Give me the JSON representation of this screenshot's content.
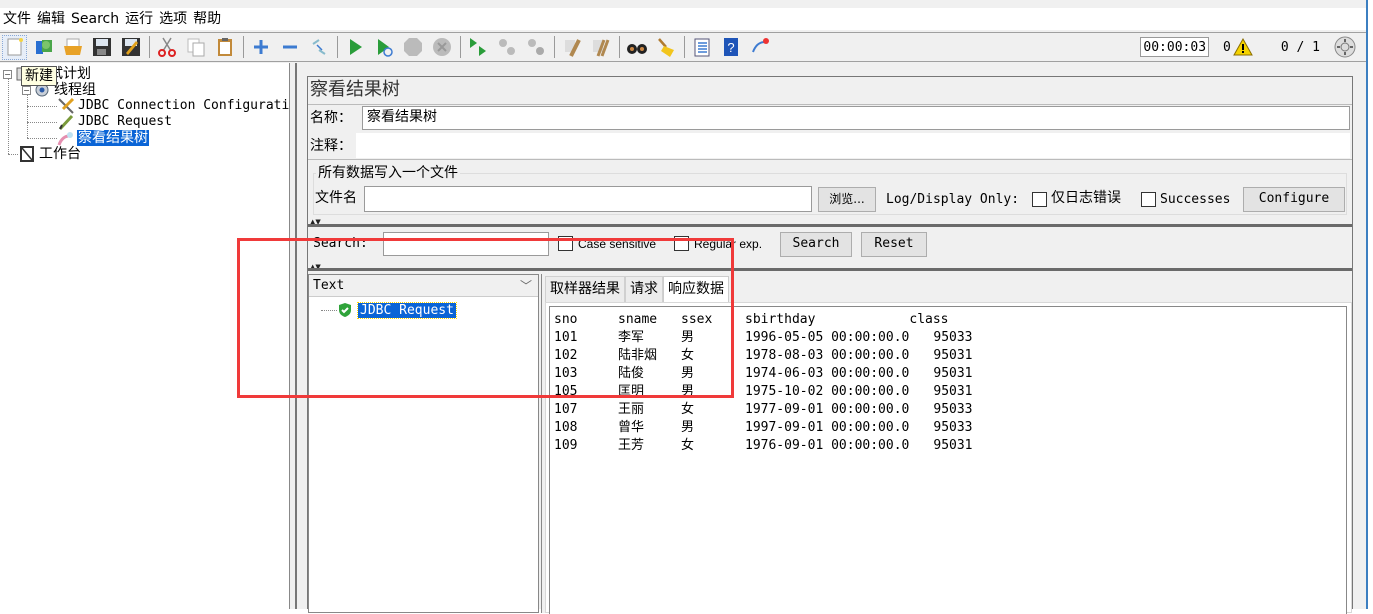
{
  "menu": [
    "文件",
    "编辑",
    "Search",
    "运行",
    "选项",
    "帮助"
  ],
  "toolbar": {
    "icons": [
      "new-icon",
      "templates-icon",
      "open-icon",
      "save-icon",
      "save-as-icon",
      "cut-icon",
      "copy-icon",
      "paste-icon",
      "expand-icon",
      "collapse-icon",
      "toggle-icon",
      "start-icon",
      "start-no-pauses-icon",
      "stop-icon",
      "shutdown-icon",
      "remote-start-icon",
      "remote-stop-icon",
      "remote-shutdown-icon",
      "clear-icon",
      "clear-all-icon",
      "search-icon",
      "reset-search-icon",
      "function-helper-icon",
      "help-icon",
      "log-viewer-icon"
    ],
    "timer": "00:00:03",
    "warning_count": "0",
    "threads": "0 / 1"
  },
  "tooltip": "新建",
  "tree": {
    "nodes": [
      {
        "label": "测试计划",
        "level": 0,
        "icon": "test-plan-icon"
      },
      {
        "label": "线程组",
        "level": 1,
        "icon": "thread-group-icon"
      },
      {
        "label": "JDBC Connection Configurati",
        "level": 2,
        "icon": "config-wrench-icon"
      },
      {
        "label": "JDBC Request",
        "level": 2,
        "icon": "sampler-pen-icon"
      },
      {
        "label": "察看结果树",
        "level": 2,
        "icon": "listener-icon",
        "selected": true
      },
      {
        "label": "工作台",
        "level": 0,
        "icon": "workbench-icon"
      }
    ]
  },
  "panel": {
    "title": "察看结果树",
    "name_label": "名称：",
    "name_value": "察看结果树",
    "comment_label": "注释：",
    "comment_value": "",
    "file_group_label": "所有数据写入一个文件",
    "filename_label": "文件名",
    "filename_value": "",
    "browse_label": "浏览...",
    "log_display_label": "Log/Display Only:",
    "errors_only_label": "仅日志错误",
    "successes_label": "Successes",
    "configure_label": "Configure"
  },
  "search": {
    "label": "Search:",
    "value": "",
    "case_sensitive_label": "Case sensitive",
    "regex_label": "Regular exp.",
    "search_button": "Search",
    "reset_button": "Reset"
  },
  "results": {
    "renderer": "Text",
    "items": [
      {
        "label": "JDBC Request",
        "status": "success"
      }
    ],
    "tabs": [
      "取样器结果",
      "请求",
      "响应数据"
    ],
    "active_tab": "响应数据",
    "columns": [
      "sno",
      "sname",
      "ssex",
      "sbirthday",
      "class"
    ],
    "rows": [
      [
        "101",
        "李军",
        "男",
        "1996-05-05 00:00:00.0",
        "95033"
      ],
      [
        "102",
        "陆非烟",
        "女",
        "1978-08-03 00:00:00.0",
        "95031"
      ],
      [
        "103",
        "陆俊",
        "男",
        "1974-06-03 00:00:00.0",
        "95031"
      ],
      [
        "105",
        "匡明",
        "男",
        "1975-10-02 00:00:00.0",
        "95031"
      ],
      [
        "107",
        "王丽",
        "女",
        "1977-09-01 00:00:00.0",
        "95033"
      ],
      [
        "108",
        "曾华",
        "男",
        "1997-09-01 00:00:00.0",
        "95033"
      ],
      [
        "109",
        "王芳",
        "女",
        "1976-09-01 00:00:00.0",
        "95031"
      ]
    ]
  },
  "colors": {
    "selection": "#0a64d6",
    "highlight_box": "#f03a3a",
    "window_bg": "#f0f0f0"
  }
}
